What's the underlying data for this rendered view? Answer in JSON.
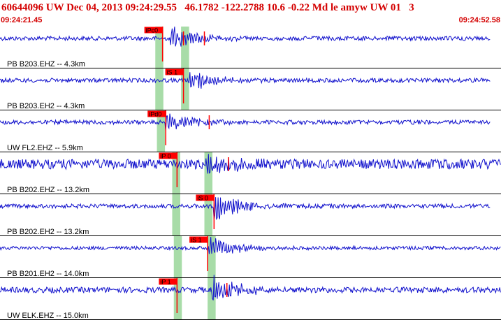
{
  "header": {
    "event_id": "60644096",
    "network": "UW",
    "origin_date": "Dec 04, 2013",
    "origin_time": "09:24:29.55",
    "latitude": "46.1782",
    "longitude": "-122.2788",
    "depth": "10.6",
    "magnitude": "-0.22",
    "magnitude_type": "Md",
    "event_type": "le",
    "author": "amyw",
    "source": "UW 01",
    "version": "3",
    "time_start": "09:24:21.45",
    "time_end": "09:24:52.58"
  },
  "colors": {
    "trace": "#1010cc",
    "pick": "#ff0000",
    "text_red": "#d40000",
    "window": "#a8dca8",
    "separator": "#000000"
  },
  "chart_data": {
    "type": "line",
    "title": "60644096 UW Dec 04, 2013 09:24:29.55 46.1782 -122.2788 10.6 -0.22 Md le amyw UW 01 3",
    "x_range": [
      "09:24:21.45",
      "09:24:52.58"
    ],
    "x_duration_s": 31.13,
    "grid": false,
    "channels": [
      {
        "label": "PB B203.EHZ -- 4.3km",
        "trace_end_s": 30.5,
        "amplitude": 3,
        "onset_s": 10.6,
        "peak_amplitude": 22,
        "picks": [
          {
            "label": "iPc0",
            "time_s": 10.1
          }
        ],
        "windows": [
          {
            "start_s": 9.65,
            "end_s": 10.15
          },
          {
            "start_s": 11.25,
            "end_s": 11.75
          }
        ],
        "marks_s": [
          11.4,
          12.7
        ]
      },
      {
        "label": "PB B203.EH2 -- 4.3km",
        "trace_end_s": 30.5,
        "amplitude": 3,
        "onset_s": 11.7,
        "peak_amplitude": 18,
        "picks": [
          {
            "label": "iS 1",
            "time_s": 11.4
          }
        ],
        "windows": [
          {
            "start_s": 9.65,
            "end_s": 10.15
          },
          {
            "start_s": 11.25,
            "end_s": 11.75
          }
        ],
        "marks_s": []
      },
      {
        "label": "UW FL2.EHZ -- 5.9km",
        "trace_end_s": 30.5,
        "amplitude": 3,
        "onset_s": 10.3,
        "peak_amplitude": 16,
        "picks": [
          {
            "label": "iPd0",
            "time_s": 10.3
          }
        ],
        "windows": [
          {
            "start_s": 9.75,
            "end_s": 10.25
          }
        ],
        "marks_s": [
          13.0
        ]
      },
      {
        "label": "PB B202.EHZ -- 13.2km",
        "trace_end_s": 31.13,
        "amplitude": 7,
        "onset_s": 12.7,
        "peak_amplitude": 22,
        "picks": [
          {
            "label": "iP 0",
            "time_s": 11.0
          }
        ],
        "windows": [
          {
            "start_s": 10.7,
            "end_s": 11.2
          },
          {
            "start_s": 12.7,
            "end_s": 13.2
          }
        ],
        "marks_s": [
          14.2
        ]
      },
      {
        "label": "PB B202.EH2 -- 13.2km",
        "trace_end_s": 30.5,
        "amplitude": 3,
        "onset_s": 13.3,
        "peak_amplitude": 26,
        "picks": [
          {
            "label": "iS 0",
            "time_s": 13.3
          }
        ],
        "windows": [
          {
            "start_s": 10.7,
            "end_s": 11.2
          },
          {
            "start_s": 12.7,
            "end_s": 13.2
          }
        ],
        "marks_s": []
      },
      {
        "label": "PB B201.EH2 -- 14.0km",
        "trace_end_s": 31.13,
        "amplitude": 2.5,
        "onset_s": 13.0,
        "peak_amplitude": 20,
        "picks": [
          {
            "label": "iS 1",
            "time_s": 12.9
          }
        ],
        "windows": [
          {
            "start_s": 10.8,
            "end_s": 11.3
          },
          {
            "start_s": 12.9,
            "end_s": 13.4
          }
        ],
        "marks_s": []
      },
      {
        "label": "UW ELK.EHZ -- 15.0km",
        "trace_end_s": 31.13,
        "amplitude": 4,
        "onset_s": 13.2,
        "peak_amplitude": 24,
        "picks": [
          {
            "label": "iP 1",
            "time_s": 11.0
          }
        ],
        "windows": [
          {
            "start_s": 10.8,
            "end_s": 11.3
          },
          {
            "start_s": 12.9,
            "end_s": 13.4
          }
        ],
        "marks_s": [
          14.1
        ]
      }
    ]
  }
}
